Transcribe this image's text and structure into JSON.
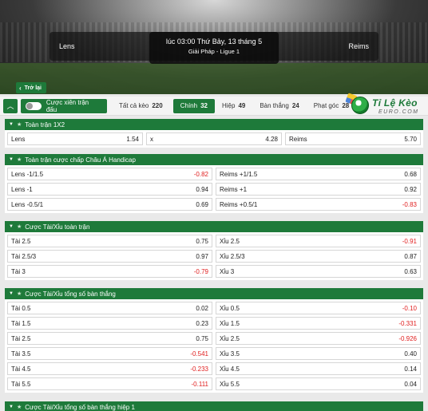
{
  "match": {
    "home": "Lens",
    "away": "Reims",
    "time": "lúc 03:00 Thứ Bảy, 13 tháng 5",
    "league": "Giải Pháp - Ligue 1"
  },
  "back_label": "Trở lại",
  "tabbar": {
    "parlay_label": "Cược xiên trận đấu",
    "tabs": [
      {
        "label": "Tất cả kèo",
        "count": "220"
      },
      {
        "label": "Chính",
        "count": "32"
      },
      {
        "label": "Hiệp",
        "count": "49"
      },
      {
        "label": "Bàn thắng",
        "count": "24"
      },
      {
        "label": "Phạt góc",
        "count": "28"
      }
    ]
  },
  "logo": {
    "line1a": "Tỉ Lệ",
    "line1b": " Kèo",
    "line2": "EURO.COM"
  },
  "colors": {
    "brand_green": "#1e7a3a",
    "negative": "#e02020"
  },
  "sections": [
    {
      "title": "Toàn trận 1X2",
      "rows": [
        [
          {
            "label": "Lens",
            "odd": "1.54"
          },
          {
            "label": "x",
            "odd": "4.28"
          },
          {
            "label": "Reims",
            "odd": "5.70"
          }
        ]
      ]
    },
    {
      "title": "Toàn trận cược chấp Châu Á Handicap",
      "rows": [
        [
          {
            "label": "Lens -1/1.5",
            "odd": "-0.82"
          },
          {
            "label": "Reims +1/1.5",
            "odd": "0.68"
          }
        ],
        [
          {
            "label": "Lens -1",
            "odd": "0.94"
          },
          {
            "label": "Reims +1",
            "odd": "0.92"
          }
        ],
        [
          {
            "label": "Lens -0.5/1",
            "odd": "0.69"
          },
          {
            "label": "Reims +0.5/1",
            "odd": "-0.83"
          }
        ]
      ]
    },
    {
      "title": "Cược Tài/Xỉu toàn trận",
      "rows": [
        [
          {
            "label": "Tài 2.5",
            "odd": "0.75"
          },
          {
            "label": "Xỉu 2.5",
            "odd": "-0.91"
          }
        ],
        [
          {
            "label": "Tài 2.5/3",
            "odd": "0.97"
          },
          {
            "label": "Xỉu 2.5/3",
            "odd": "0.87"
          }
        ],
        [
          {
            "label": "Tài 3",
            "odd": "-0.79"
          },
          {
            "label": "Xỉu 3",
            "odd": "0.63"
          }
        ]
      ]
    },
    {
      "title": "Cược Tài/Xỉu tổng số bàn thắng",
      "rows": [
        [
          {
            "label": "Tài 0.5",
            "odd": "0.02"
          },
          {
            "label": "Xỉu 0.5",
            "odd": "-0.10"
          }
        ],
        [
          {
            "label": "Tài 1.5",
            "odd": "0.23"
          },
          {
            "label": "Xỉu 1.5",
            "odd": "-0.331"
          }
        ],
        [
          {
            "label": "Tài 2.5",
            "odd": "0.75"
          },
          {
            "label": "Xỉu 2.5",
            "odd": "-0.926"
          }
        ],
        [
          {
            "label": "Tài 3.5",
            "odd": "-0.541"
          },
          {
            "label": "Xỉu 3.5",
            "odd": "0.40"
          }
        ],
        [
          {
            "label": "Tài 4.5",
            "odd": "-0.233"
          },
          {
            "label": "Xỉu 4.5",
            "odd": "0.14"
          }
        ],
        [
          {
            "label": "Tài 5.5",
            "odd": "-0.111"
          },
          {
            "label": "Xỉu 5.5",
            "odd": "0.04"
          }
        ]
      ]
    },
    {
      "title": "Cược Tài/Xỉu tổng số bàn thắng hiệp 1",
      "rows": []
    }
  ]
}
